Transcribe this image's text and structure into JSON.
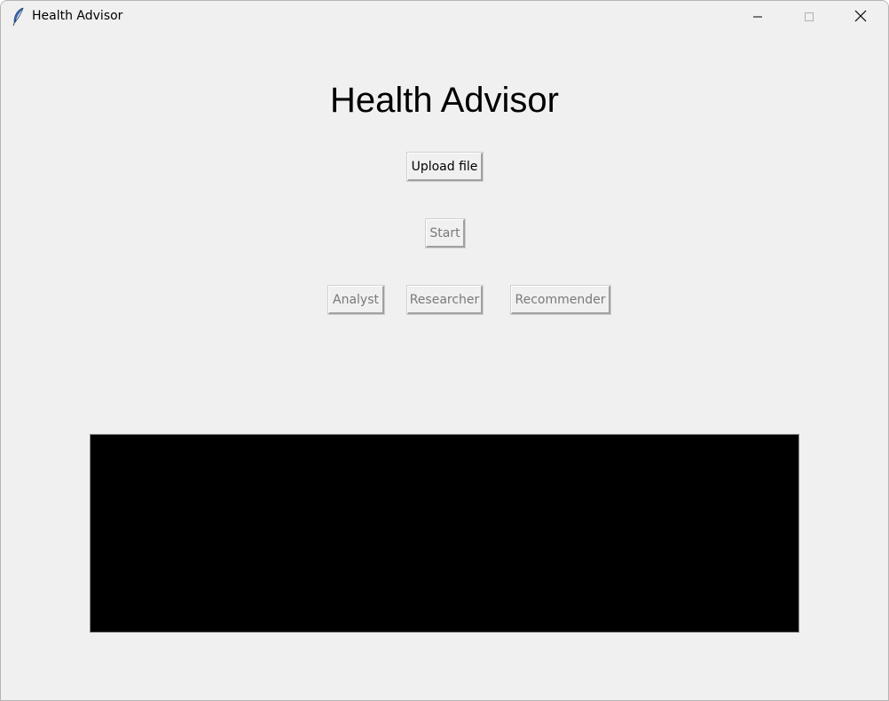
{
  "window": {
    "title": "Health Advisor",
    "app_icon": "feather-icon",
    "controls": {
      "minimize_icon": "minimize-icon",
      "maximize_icon": "maximize-icon",
      "close_icon": "close-icon"
    }
  },
  "main": {
    "heading": "Health Advisor",
    "buttons": {
      "upload_label": "Upload file",
      "start_label": "Start",
      "analyst_label": "Analyst",
      "researcher_label": "Researcher",
      "recommender_label": "Recommender"
    },
    "output_text": ""
  },
  "colors": {
    "window_bg": "#f0f0f0",
    "output_bg": "#000000",
    "disabled_text": "#7a7a7a"
  }
}
